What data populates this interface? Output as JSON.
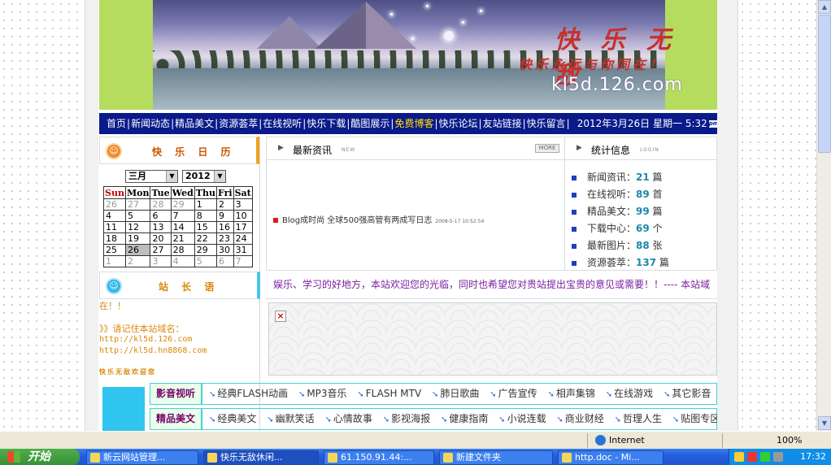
{
  "banner": {
    "title": "快 乐 无 敌",
    "slogan": "快乐永远与你同在！",
    "domain": "kl5d.126.com"
  },
  "nav": {
    "items": [
      "首页",
      "新闻动态",
      "精品美文",
      "资源荟萃",
      "在线视听",
      "快乐下载",
      "酷图展示",
      "免费博客",
      "快乐论坛",
      "友站链接",
      "快乐留言"
    ],
    "highlighted": "免费博客",
    "date": "2012年3月26日",
    "weekday": "星期一",
    "time": "5:32"
  },
  "calendar": {
    "title": "快 乐 日 历",
    "month": "三月",
    "year": "2012",
    "weekdays": [
      "Sun",
      "Mon",
      "Tue",
      "Wed",
      "Thu",
      "Fri",
      "Sat"
    ],
    "weeks": [
      [
        "26",
        "27",
        "28",
        "29",
        "1",
        "2",
        "3"
      ],
      [
        "4",
        "5",
        "6",
        "7",
        "8",
        "9",
        "10"
      ],
      [
        "11",
        "12",
        "13",
        "14",
        "15",
        "16",
        "17"
      ],
      [
        "18",
        "19",
        "20",
        "21",
        "22",
        "23",
        "24"
      ],
      [
        "25",
        "26",
        "27",
        "28",
        "29",
        "30",
        "31"
      ],
      [
        "1",
        "2",
        "3",
        "4",
        "5",
        "6",
        "7"
      ]
    ],
    "today": "26"
  },
  "admin": {
    "title": "站 长 语",
    "line1": "在！！",
    "line2": "》》请记住本站域名：",
    "url1": "http://kl5d.126.com",
    "url2": "http://kl5d.hn8868.com",
    "footer": "快乐无敌欢迎您"
  },
  "news": {
    "title": "最新资讯",
    "title_en": "NEW",
    "more": "MORE",
    "item_title": "Blog成时尚 全球500强高管有两成写日志",
    "item_time": "2008-5-17 10:52:54"
  },
  "stats": {
    "title": "统计信息",
    "title_en": "LOGIN",
    "rows": [
      {
        "label": "新闻资讯：",
        "num": "21",
        "unit": "篇"
      },
      {
        "label": "在线视听：",
        "num": "89",
        "unit": "首"
      },
      {
        "label": "精品美文：",
        "num": "99",
        "unit": "篇"
      },
      {
        "label": "下载中心：",
        "num": "69",
        "unit": "个"
      },
      {
        "label": "最新图片：",
        "num": "88",
        "unit": "张"
      },
      {
        "label": "资源荟萃：",
        "num": "137",
        "unit": "篇"
      }
    ]
  },
  "marquee": "娱乐、学习的好地方，本站欢迎您的光临，同时也希望您对贵站提出宝贵的意见或需要！！---- 本站域",
  "categories": [
    {
      "label": "影音视听",
      "items": [
        "经典FLASH动画",
        "MP3音乐",
        "FLASH MTV",
        "肺日歌曲",
        "广告宣传",
        "相声集锦",
        "在线游戏",
        "其它影音"
      ]
    },
    {
      "label": "精品美文",
      "items": [
        "经典美文",
        "幽默笑话",
        "心情故事",
        "影视海报",
        "健康指南",
        "小说连载",
        "商业财经",
        "哲理人生",
        "贴图专区"
      ]
    }
  ],
  "statusbar": {
    "zone": "Internet",
    "zoom": "100%"
  },
  "taskbar": {
    "start": "开始",
    "tasks": [
      "新云网站管理...",
      "快乐无敌休闲...",
      "61.150.91.44:...",
      "新建文件夹",
      "http.doc - Mi..."
    ],
    "clock": "17:32"
  },
  "colors": {
    "nav_bg": "#0a1a8a",
    "banner_green": "#b5dc5f",
    "accent_orange": "#f2a01c",
    "accent_cyan": "#49c4e8",
    "link_purple": "#7a1fa0",
    "stat_number": "#1a8aa8"
  }
}
